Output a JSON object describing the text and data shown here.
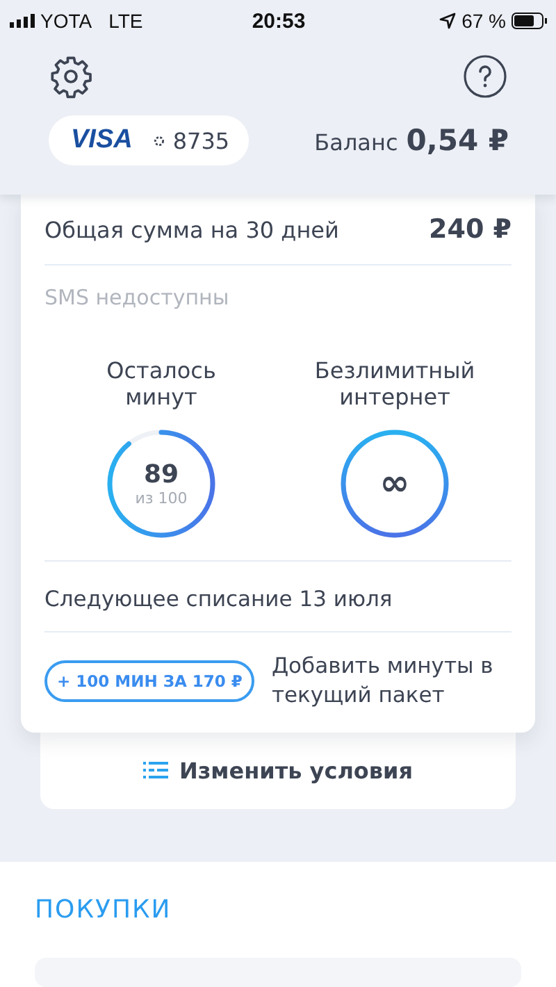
{
  "status_bar": {
    "carrier": "YOTA",
    "network": "LTE",
    "time": "20:53",
    "battery_text": "67 %"
  },
  "header": {
    "card": {
      "brand": "VISA",
      "number": "8735"
    },
    "balance_label": "Баланс",
    "balance_value": "0,54 ₽"
  },
  "plan": {
    "total_label": "Общая сумма на 30 дней",
    "total_value": "240 ₽",
    "sms_note": "SMS недоступны",
    "meters": [
      {
        "kind": "count",
        "title": "Осталось минут",
        "value": "89",
        "subtitle": "из 100",
        "level": 0.89
      },
      {
        "kind": "unlimited",
        "title": "Безлимитный интернет",
        "value": "∞"
      }
    ],
    "next_charge": "Следующее списание 13 июля",
    "addon_button": "+ 100 МИН ЗА 170 ₽",
    "addon_text": "Добавить минуты в текущий пакет"
  },
  "change_button": "Изменить условия",
  "purchases": {
    "title": "ПОКУПКИ"
  }
}
